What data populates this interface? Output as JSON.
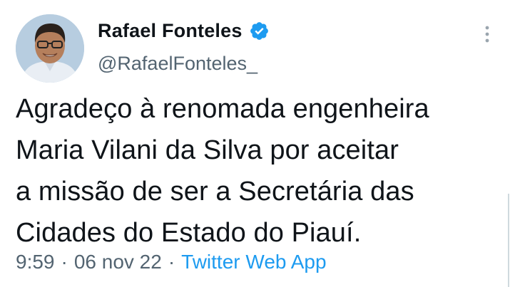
{
  "author": {
    "display_name": "Rafael Fonteles",
    "handle": "@RafaelFonteles_",
    "avatar_icon": "profile-photo",
    "verified_icon": "verified-badge-icon",
    "verified_color": "#1d9bf0"
  },
  "menu": {
    "more_icon": "more-vertical-icon"
  },
  "tweet": {
    "text": "Agradeço à renomada engenheira\nMaria Vilani da Silva por aceitar\na missão de ser a Secretária das\nCidades do Estado do Piauí."
  },
  "meta": {
    "time": "9:59",
    "separator": "·",
    "date": "06 nov 22",
    "source": "Twitter Web App",
    "source_color": "#1d9bf0",
    "muted_color": "#536471"
  }
}
